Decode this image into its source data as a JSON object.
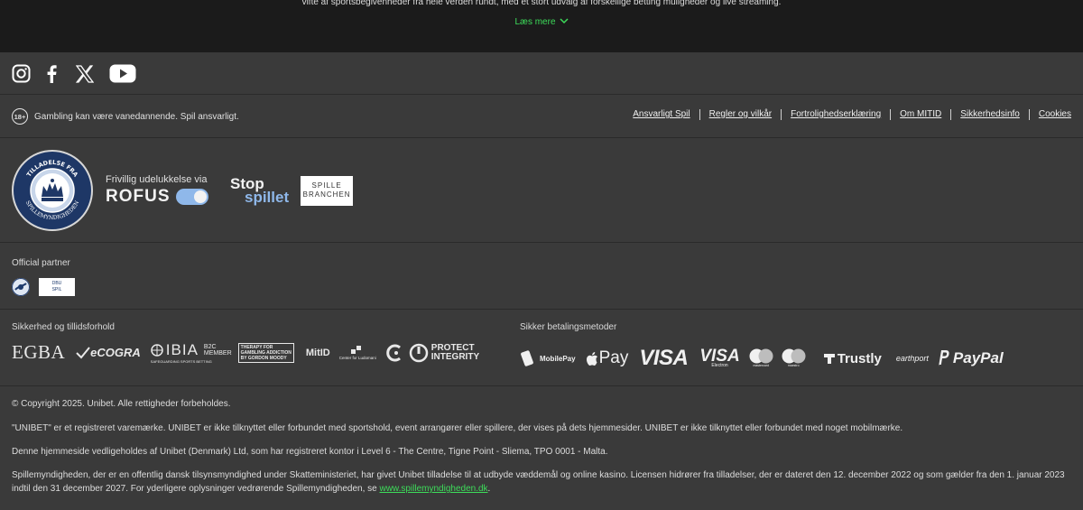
{
  "top": {
    "intro_text": "vifte af sportsbegivenheder fra hele verden rundt, med et stort udvalg af forskellige betting muligheder og live streaming.",
    "read_more": "Læs mere"
  },
  "social": {
    "icons": [
      "instagram-icon",
      "facebook-icon",
      "x-icon",
      "youtube-icon"
    ]
  },
  "responsible": {
    "age_badge": "18+",
    "text": "Gambling kan være vanedannende. Spil ansvarligt."
  },
  "footer_links": [
    "Ansvarligt Spil",
    "Regler og vilkår",
    "Fortrolighedserklæring",
    "Om MITID",
    "Sikkerhedsinfo",
    "Cookies"
  ],
  "license": {
    "seal_top": "TILLADELSE FRA",
    "seal_bottom": "SPILLEMYNDIGHEDEN",
    "rofus_line1": "Frivillig udelukkelse via",
    "rofus_line2": "ROFUS",
    "stop_line1": "Stop",
    "stop_line2": "spillet",
    "spille_line1": "SPILLE",
    "spille_line2": "BRANCHEN"
  },
  "official_partner": {
    "heading": "Official partner",
    "p2_line1": "DBU",
    "p2_line2": "SPIL"
  },
  "security": {
    "heading": "Sikkerhed og tillidsforhold",
    "egba": "EGBA",
    "ecogra": "eCOGRA",
    "ibia": "IBIA",
    "ibia_b2c_1": "B2C",
    "ibia_b2c_2": "MEMBER",
    "ibia_sub": "SAFEGUARDING SPORTS BETTING",
    "therapy_1": "THERAPY FOR",
    "therapy_2": "GAMBLING ADDICTION",
    "therapy_3": "BY GORDON MOODY",
    "mitid": "MitID",
    "cfg": "Center for Ludomani",
    "protect_1": "PROTECT",
    "protect_2": "INTEGRITY"
  },
  "payments": {
    "heading": "Sikker betalingsmetoder",
    "mobilepay": "MobilePay",
    "applepay": "Pay",
    "visa": "VISA",
    "visa_e": "VISA",
    "visa_e_sub": "Electron",
    "mc1_sub": "mastercard",
    "mc2_sub": "maestro",
    "trustly": "Trustly",
    "earthport": "earthport",
    "paypal": "PayPal"
  },
  "legal": {
    "copyright": "© Copyright 2025. Unibet. Alle rettigheder forbeholdes.",
    "trademark": "\"UNIBET\" er et registreret varemærke. UNIBET er ikke tilknyttet eller forbundet med sportshold, event arrangører eller spillere, der vises på dets hjemmesider. UNIBET er ikke tilknyttet eller forbundet med noget mobilmærke.",
    "owner": "Denne hjemmeside vedligeholdes af Unibet (Denmark) Ltd, som har registreret kontor i Level 6 - The Centre, Tigne Point - Sliema, TPO 0001 - Malta.",
    "regulator_1": "Spillemyndigheden, der er en offentlig dansk tilsynsmyndighed under Skatteministeriet, har givet Unibet tilladelse til at udbyde væddemål og online kasino. Licensen hidrører fra tilladelser, der er dateret den 12. december 2022 og som gælder fra den 1. januar 2023",
    "regulator_2": "indtil den 31 december 2027. For yderligere oplysninger vedrørende Spillemyndigheden, se ",
    "regulator_link": "www.spillemyndigheden.dk",
    "regulator_end": "."
  }
}
